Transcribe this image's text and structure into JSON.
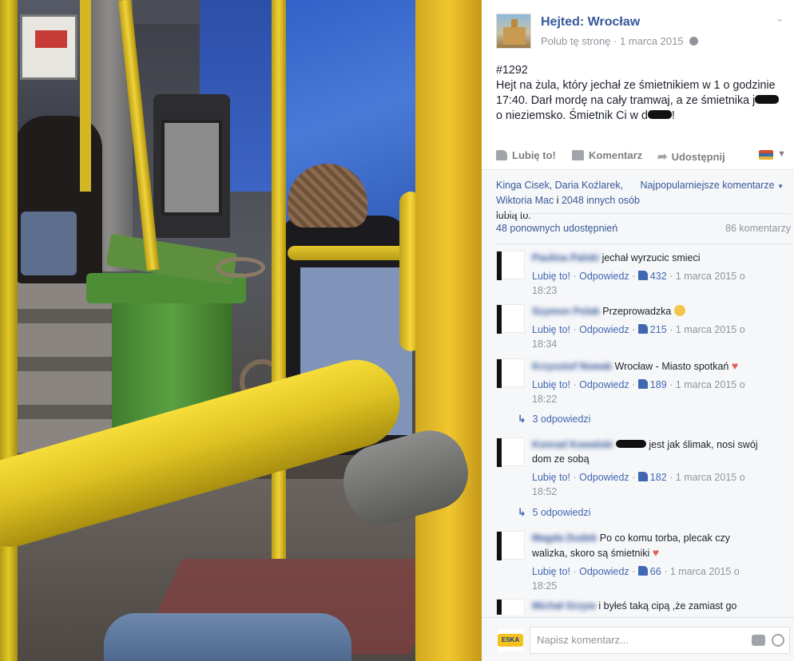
{
  "photo": {
    "description_icon": "tram-interior-photo"
  },
  "post_header": {
    "page_name": "Hejted: Wrocław",
    "like_page": "Polub tę stronę",
    "separator": "·",
    "date": "1 marca 2015"
  },
  "post": {
    "number": "#1292",
    "text_before": "Hejt na żula, który jechał ze śmietnikiem w 1 o godzinie 17:40. Darł mordę na cały tramwaj, a ze śmietnika j",
    "text_middle": "o nieziemsko. Śmietnik Ci w d",
    "text_end": "!"
  },
  "actions": {
    "like": "Lubię to!",
    "comment": "Komentarz",
    "share": "Udostępnij"
  },
  "likers": {
    "names_1": "Kinga Cisek, Daria Koźlarek, Wiktoria Mac",
    "and": " i ",
    "others": "2048 innych osób",
    "suffix": " lubią to.",
    "sort": "Najpopularniejsze komentarze"
  },
  "stats": {
    "shares": "48 ponownych udostępnień",
    "comments": "86 komentarzy"
  },
  "comments": [
    {
      "author": "Paulina Palski",
      "text": "jechał wyrzucic smieci",
      "like_label": "Lubię to!",
      "reply_label": "Odpowiedz",
      "likes": "432",
      "time_line1": "1 marca 2015 o",
      "time_line2": "18:23"
    },
    {
      "author": "Szymon Polak",
      "text": "Przeprowadzka",
      "like_label": "Lubię to!",
      "reply_label": "Odpowiedz",
      "likes": "215",
      "time_line1": "1 marca 2015 o",
      "time_line2": "18:34"
    },
    {
      "author": "Krzysztof Nowak",
      "text": "Wrocław - Miasto spotkań",
      "like_label": "Lubię to!",
      "reply_label": "Odpowiedz",
      "likes": "189",
      "time_line1": "1 marca 2015 o",
      "time_line2": "18:22",
      "replies": "3 odpowiedzi"
    },
    {
      "author": "Konrad Kowalski",
      "text_a": "jest jak ślimak, nosi swój",
      "text_b": "dom ze sobą",
      "like_label": "Lubię to!",
      "reply_label": "Odpowiedz",
      "likes": "182",
      "time_line1": "1 marca 2015 o",
      "time_line2": "18:52",
      "replies": "5 odpowiedzi"
    },
    {
      "author": "Magda Dudek",
      "text_a": "Po co komu torba, plecak czy",
      "text_b": "walizka, skoro są śmietniki",
      "like_label": "Lubię to!",
      "reply_label": "Odpowiedz",
      "likes": "66",
      "time_line1": "1 marca 2015 o",
      "time_line2": "18:25"
    },
    {
      "author": "Michał Grzyw",
      "text": "i byłeś taką cipą ,że zamiast go"
    }
  ],
  "composer": {
    "placeholder": "Napisz komentarz...",
    "avatar_text": "ESKA"
  },
  "colors": {
    "link": "#365899",
    "action_link": "#4267b2",
    "meta": "#90949c",
    "heart": "#e0615c"
  }
}
